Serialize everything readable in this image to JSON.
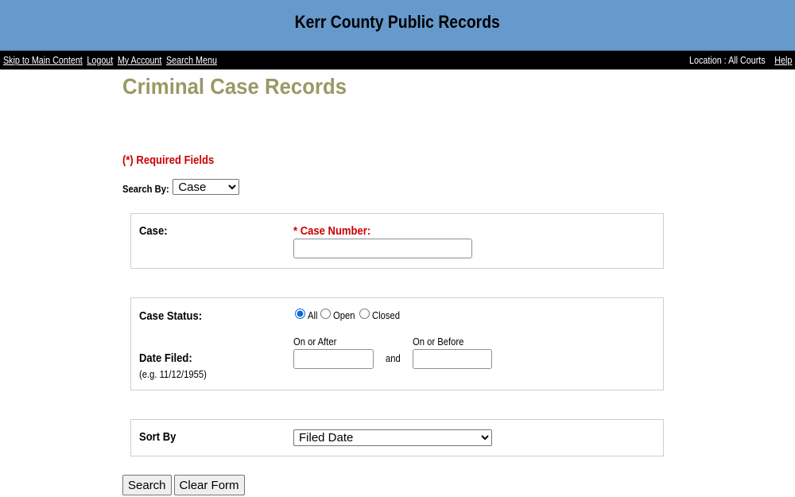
{
  "header": {
    "site_title": "Kerr County Public Records"
  },
  "nav": {
    "links": [
      {
        "label": "Skip to Main Content"
      },
      {
        "label": "Logout"
      },
      {
        "label": "My Account"
      },
      {
        "label": "Search Menu"
      }
    ],
    "location_text": "Location : All Courts",
    "help_label": "Help"
  },
  "page": {
    "title": "Criminal Case Records",
    "required_note": "(*) Required Fields"
  },
  "search_by": {
    "label": "Search By:",
    "selected": "Case"
  },
  "case_panel": {
    "section_label": "Case:",
    "case_number_label": "* Case Number:",
    "case_number_value": ""
  },
  "status_panel": {
    "case_status_label": "Case Status:",
    "status_options": [
      {
        "label": "All",
        "checked": true
      },
      {
        "label": "Open",
        "checked": false
      },
      {
        "label": "Closed",
        "checked": false
      }
    ],
    "date_filed_label": "Date Filed:",
    "date_example": "(e.g. 11/12/1955)",
    "on_or_after_label": "On or After",
    "on_or_after_value": "",
    "and_text": "and",
    "on_or_before_label": "On or Before",
    "on_or_before_value": ""
  },
  "sort_panel": {
    "label": "Sort By",
    "selected": "Filed Date"
  },
  "actions": {
    "search_label": "Search",
    "clear_label": "Clear Form"
  }
}
